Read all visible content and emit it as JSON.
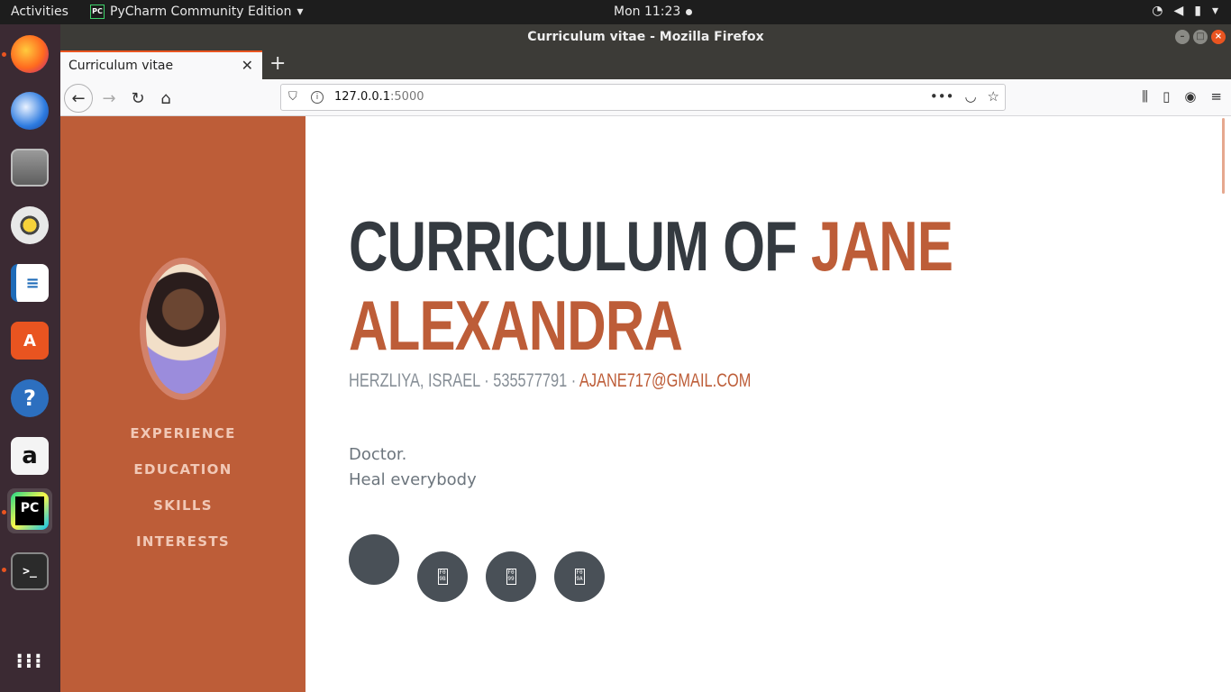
{
  "topbar": {
    "activities": "Activities",
    "app_name": "PyCharm Community Edition",
    "app_icon_text": "PC",
    "clock": "Mon 11:23"
  },
  "dock": {
    "items": [
      "firefox-icon",
      "thunderbird-icon",
      "files-icon",
      "rhythmbox-icon",
      "writer-icon",
      "software-icon",
      "help-icon",
      "amazon-icon",
      "pycharm-icon",
      "terminal-icon",
      "app-grid-icon"
    ],
    "pycharm_label": "PC"
  },
  "window": {
    "title": "Curriculum vitae - Mozilla Firefox"
  },
  "tab": {
    "title": "Curriculum vitae"
  },
  "urlbar": {
    "host": "127.0.0.1",
    "port": ":5000"
  },
  "page": {
    "accent_color": "#bd5d38",
    "nav": [
      "Experience",
      "Education",
      "Skills",
      "Interests"
    ],
    "name_prefix": "CURRICULUM OF",
    "name_first": "JANE",
    "name_last": "ALEXANDRA",
    "location": "Herzliya, Israel",
    "separator": "·",
    "phone": "535577791",
    "email": "ajane717@gmail.com",
    "lead_line1": "Doctor.",
    "lead_line2": "Heal everybody",
    "social_glyphs": [
      "",
      "F0 9B",
      "F0 99",
      "F0 9A"
    ]
  }
}
